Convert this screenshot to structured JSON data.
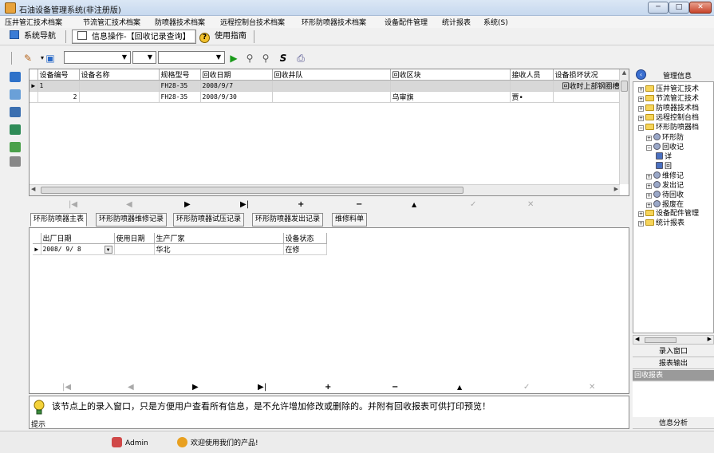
{
  "window": {
    "title": "石油设备管理系统(非注册版)",
    "min_label": "─",
    "max_label": "□",
    "close_label": "✕"
  },
  "menu": [
    "压井管汇技术档案",
    "节流管汇技术档案",
    "防喷器技术档案",
    "远程控制台技术档案",
    "环形防喷器技术档案",
    "设备配件管理",
    "统计报表",
    "系统(S)"
  ],
  "nav": {
    "system_nav": "系统导航",
    "operate": "信息操作-【回收记录查询】",
    "guide": "使用指南"
  },
  "toolbar": {
    "combo1": "",
    "combo2": "",
    "combo3": ""
  },
  "grid": {
    "headers": [
      "设备编号",
      "设备名称",
      "规格型号",
      "回收日期",
      "回收井队",
      "回收区块",
      "接收人员",
      "设备损坏状况"
    ],
    "rows": [
      [
        "1",
        "",
        "FH28-35",
        "2008/9/7",
        "",
        "",
        "",
        "回收时上部钢圈槽"
      ],
      [
        "2",
        "",
        "FH28-35",
        "2008/9/30",
        "",
        "乌审旗",
        "贾•",
        ""
      ]
    ]
  },
  "navigator": {
    "first": "|◀",
    "prev": "◀",
    "next": "▶",
    "last": "▶|",
    "add": "+",
    "delete": "−",
    "up": "▲",
    "post": "✓",
    "cancel": "✕"
  },
  "tabs": [
    "环形防喷器主表",
    "环形防喷器维修记录",
    "环形防喷器试压记录",
    "环形防喷器发出记录",
    "维修料单"
  ],
  "detail": {
    "headers": [
      "出厂日期",
      "使用日期",
      "生产厂家",
      "设备状态"
    ],
    "rows": [
      [
        "2008/ 9/ 8",
        "",
        "华北",
        "在修"
      ]
    ]
  },
  "message": {
    "text": "该节点上的录入窗口，只是方便用户查看所有信息，是不允许增加修改或删除的。并附有回收报表可供打印预览！",
    "label": "提示"
  },
  "right_panel": {
    "title": "管理信息",
    "tree": [
      {
        "label": "压井管汇技术",
        "level": 0,
        "type": "folder",
        "exp": "+"
      },
      {
        "label": "节流管汇技术",
        "level": 0,
        "type": "folder",
        "exp": "+"
      },
      {
        "label": "防喷器技术档",
        "level": 0,
        "type": "folder",
        "exp": "+"
      },
      {
        "label": "远程控制台档",
        "level": 0,
        "type": "folder",
        "exp": "+"
      },
      {
        "label": "环形防喷器档",
        "level": 0,
        "type": "folder",
        "exp": "−"
      },
      {
        "label": "环形防",
        "level": 1,
        "type": "node",
        "exp": "+"
      },
      {
        "label": "回收记",
        "level": 1,
        "type": "node",
        "exp": "−"
      },
      {
        "label": "详",
        "level": 2,
        "type": "leaf",
        "exp": ""
      },
      {
        "label": "回",
        "level": 2,
        "type": "leaf",
        "exp": ""
      },
      {
        "label": "维修记",
        "level": 1,
        "type": "node",
        "exp": "+"
      },
      {
        "label": "发出记",
        "level": 1,
        "type": "node",
        "exp": "+"
      },
      {
        "label": "待回收",
        "level": 1,
        "type": "node",
        "exp": "+"
      },
      {
        "label": "报废在",
        "level": 1,
        "type": "node",
        "exp": "+"
      },
      {
        "label": "设备配件管理",
        "level": 0,
        "type": "folder",
        "exp": "+"
      },
      {
        "label": "统计报表",
        "level": 0,
        "type": "folder",
        "exp": "+"
      }
    ],
    "btn_input": "录入窗口",
    "btn_report": "报表输出",
    "report_item": "回收报表",
    "btn_analysis": "信息分析"
  },
  "status": {
    "user": "Admin",
    "welcome": "欢迎使用我们的产品!"
  }
}
